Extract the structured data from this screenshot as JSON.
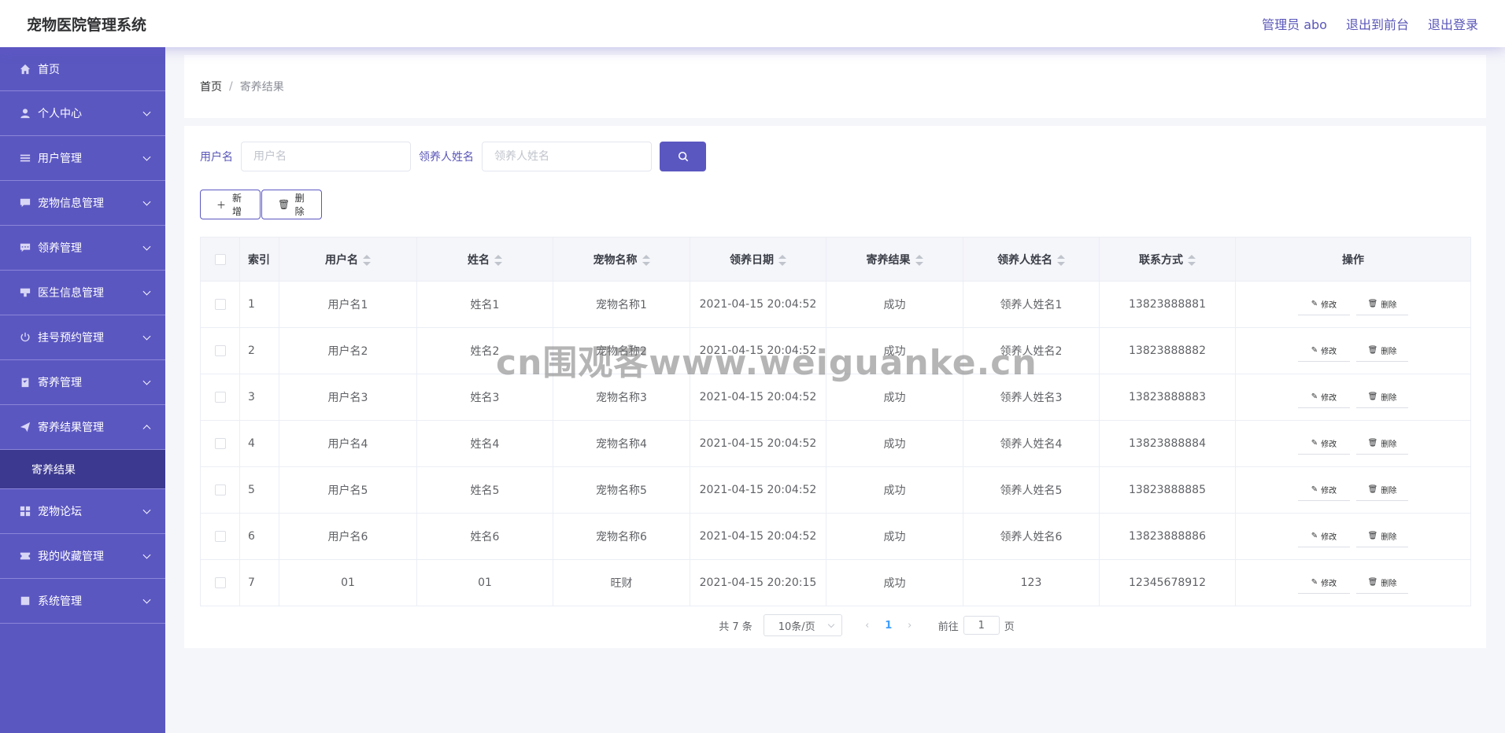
{
  "header": {
    "title": "宠物医院管理系统",
    "admin_label": "管理员 abo",
    "to_front_label": "退出到前台",
    "logout_label": "退出登录"
  },
  "sidebar": {
    "items": [
      {
        "label": "首页",
        "icon": "home-icon"
      },
      {
        "label": "个人中心",
        "icon": "user-icon"
      },
      {
        "label": "用户管理",
        "icon": "list-icon"
      },
      {
        "label": "宠物信息管理",
        "icon": "chat-icon"
      },
      {
        "label": "领养管理",
        "icon": "message-icon"
      },
      {
        "label": "医生信息管理",
        "icon": "medicine-icon"
      },
      {
        "label": "挂号预约管理",
        "icon": "power-icon"
      },
      {
        "label": "寄养管理",
        "icon": "clipboard-icon"
      },
      {
        "label": "寄养结果管理",
        "icon": "send-icon"
      },
      {
        "label": "寄养结果",
        "icon": ""
      },
      {
        "label": "宠物论坛",
        "icon": "grid-icon"
      },
      {
        "label": "我的收藏管理",
        "icon": "ticket-icon"
      },
      {
        "label": "系统管理",
        "icon": "box-icon"
      }
    ]
  },
  "breadcrumb": {
    "home": "首页",
    "separator": "/",
    "current": "寄养结果"
  },
  "search": {
    "username_label": "用户名",
    "username_placeholder": "用户名",
    "adopter_label": "领养人姓名",
    "adopter_placeholder": "领养人姓名"
  },
  "actions": {
    "add_label": "新增",
    "delete_label": "删除"
  },
  "table": {
    "headers": [
      "索引",
      "用户名",
      "姓名",
      "宠物名称",
      "领养日期",
      "寄养结果",
      "领养人姓名",
      "联系方式",
      "操作"
    ],
    "rows": [
      [
        "1",
        "用户名1",
        "姓名1",
        "宠物名称1",
        "2021-04-15 20:04:52",
        "成功",
        "领养人姓名1",
        "13823888881"
      ],
      [
        "2",
        "用户名2",
        "姓名2",
        "宠物名称2",
        "2021-04-15 20:04:52",
        "成功",
        "领养人姓名2",
        "13823888882"
      ],
      [
        "3",
        "用户名3",
        "姓名3",
        "宠物名称3",
        "2021-04-15 20:04:52",
        "成功",
        "领养人姓名3",
        "13823888883"
      ],
      [
        "4",
        "用户名4",
        "姓名4",
        "宠物名称4",
        "2021-04-15 20:04:52",
        "成功",
        "领养人姓名4",
        "13823888884"
      ],
      [
        "5",
        "用户名5",
        "姓名5",
        "宠物名称5",
        "2021-04-15 20:04:52",
        "成功",
        "领养人姓名5",
        "13823888885"
      ],
      [
        "6",
        "用户名6",
        "姓名6",
        "宠物名称6",
        "2021-04-15 20:04:52",
        "成功",
        "领养人姓名6",
        "13823888886"
      ],
      [
        "7",
        "01",
        "01",
        "旺财",
        "2021-04-15 20:20:15",
        "成功",
        "123",
        "12345678912"
      ]
    ],
    "edit_label": "修改",
    "delete_label": "删除"
  },
  "pagination": {
    "total": "共 7 条",
    "page_size": "10条/页",
    "current_page": "1",
    "goto_label": "前往",
    "goto_value": "1",
    "page_suffix": "页"
  },
  "watermark": "cn围观客www.weiguanke.cn",
  "colors": {
    "sidebar_bg": "#5b57c1",
    "sidebar_active_bg": "#3c3990",
    "accent": "#5b57c1",
    "page_active": "#409eff"
  }
}
